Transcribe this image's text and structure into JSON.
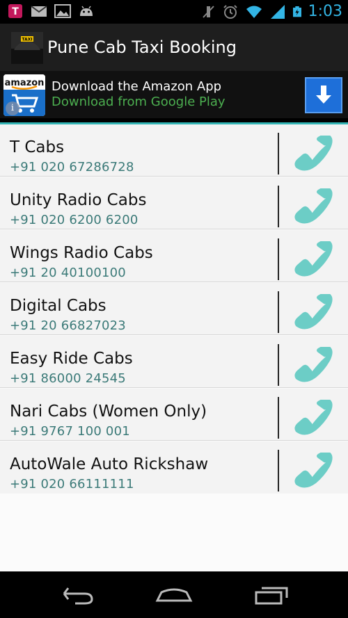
{
  "status_bar": {
    "time": "1:03",
    "icons": [
      "tmobile-icon",
      "messages-icon",
      "gallery-icon",
      "android-icon",
      "mute-icon",
      "alarm-icon",
      "wifi-icon",
      "signal-icon",
      "battery-icon"
    ]
  },
  "action_bar": {
    "title": "Pune Cab Taxi Booking"
  },
  "ad": {
    "line1": "Download the Amazon App",
    "line2": "Download from Google Play",
    "logo_text": "amazon",
    "info": "i",
    "accent": "#1e6fd9",
    "line2_color": "#4caf50"
  },
  "list": {
    "accent": "#33b5b5",
    "items": [
      {
        "name": "T Cabs",
        "phone": "+91 020 67286728"
      },
      {
        "name": "Unity Radio Cabs",
        "phone": "+91 020 6200 6200"
      },
      {
        "name": "Wings Radio Cabs",
        "phone": "+91 20 40100100"
      },
      {
        "name": "Digital Cabs",
        "phone": "+91 20 66827023"
      },
      {
        "name": "Easy Ride Cabs",
        "phone": "+91 86000 24545"
      },
      {
        "name": "Nari Cabs (Women Only)",
        "phone": "+91 9767 100 001"
      },
      {
        "name": "AutoWale Auto Rickshaw",
        "phone": "+91 020 66111111"
      }
    ]
  },
  "nav_bar": {
    "buttons": [
      "back-icon",
      "home-icon",
      "recent-apps-icon"
    ]
  }
}
